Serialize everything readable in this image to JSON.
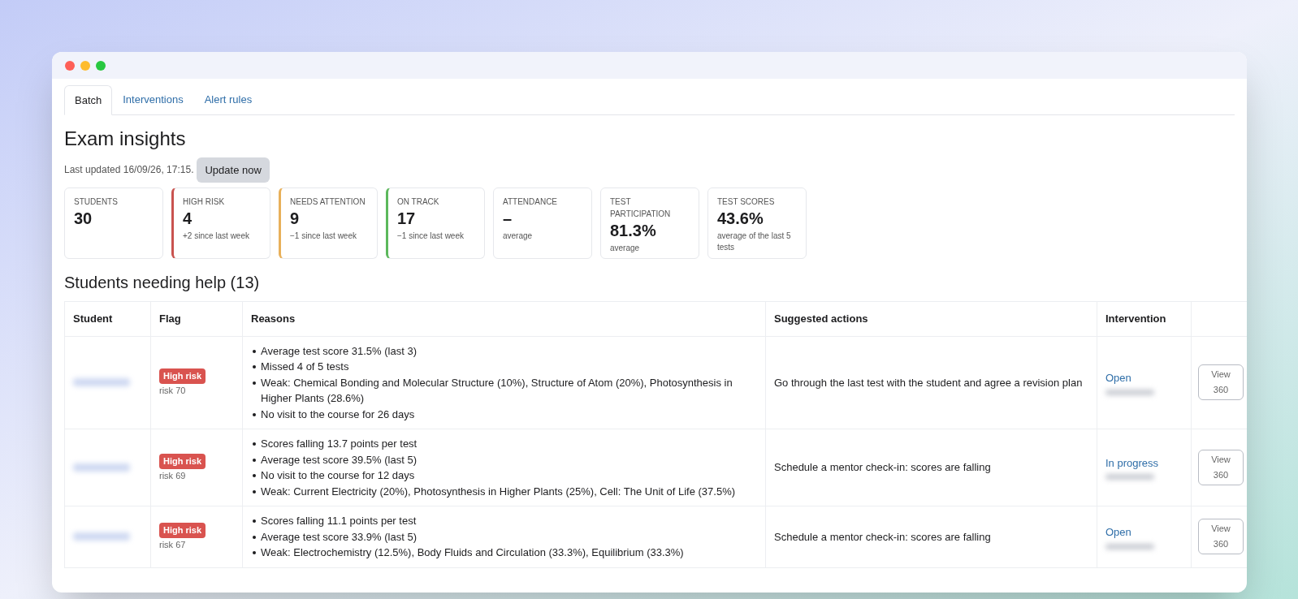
{
  "tabs": [
    {
      "label": "Batch",
      "selected": true
    },
    {
      "label": "Interventions",
      "selected": false
    },
    {
      "label": "Alert rules",
      "selected": false
    }
  ],
  "title": "Exam insights",
  "last_updated": "Last updated 16/09/26, 17:15.",
  "update_button": "Update now",
  "stats": [
    {
      "label": "STUDENTS",
      "value": "30"
    },
    {
      "label": "HIGH RISK",
      "value": "4",
      "note": "+2 since last week",
      "color": "#c9534f"
    },
    {
      "label": "NEEDS ATTENTION",
      "value": "9",
      "note": "−1 since last week",
      "color": "#e8b05a"
    },
    {
      "label": "ON TRACK",
      "value": "17",
      "note": "−1 since last week",
      "color": "#5cb85c"
    },
    {
      "label": "ATTENDANCE",
      "value": "–",
      "note": "average"
    },
    {
      "label": "TEST PARTICIPATION",
      "value": "81.3%",
      "note": "average"
    },
    {
      "label": "TEST SCORES",
      "value": "43.6%",
      "note": "average of the last 5 tests"
    }
  ],
  "section_title": "Students needing help (13)",
  "table": {
    "columns": [
      "Student",
      "Flag",
      "Reasons",
      "Suggested actions",
      "Intervention"
    ],
    "rows": [
      {
        "flag": "High risk",
        "risk": "risk 70",
        "reasons": [
          "Average test score 31.5% (last 3)",
          "Missed 4 of 5 tests",
          "Weak: Chemical Bonding and Molecular Structure (10%), Structure of Atom (20%), Photosynthesis in Higher Plants (28.6%)",
          "No visit to the course for 26 days"
        ],
        "action": "Go through the last test with the student and agree a revision plan",
        "intervention": "Open",
        "button": "View 360"
      },
      {
        "flag": "High risk",
        "risk": "risk 69",
        "reasons": [
          "Scores falling 13.7 points per test",
          "Average test score 39.5% (last 5)",
          "No visit to the course for 12 days",
          "Weak: Current Electricity (20%), Photosynthesis in Higher Plants (25%), Cell: The Unit of Life (37.5%)"
        ],
        "action": "Schedule a mentor check-in: scores are falling",
        "intervention": "In progress",
        "button": "View 360"
      },
      {
        "flag": "High risk",
        "risk": "risk 67",
        "reasons": [
          "Scores falling 11.1 points per test",
          "Average test score 33.9% (last 5)",
          "Weak: Electrochemistry (12.5%), Body Fluids and Circulation (33.3%), Equilibrium (33.3%)"
        ],
        "action": "Schedule a mentor check-in: scores are falling",
        "intervention": "Open",
        "button": "View 360"
      }
    ]
  }
}
